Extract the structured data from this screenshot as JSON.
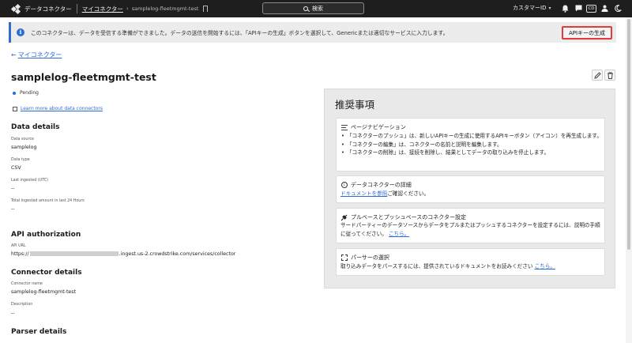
{
  "topbar": {
    "app_title": "データコネクター",
    "breadcrumb_link": "マイコネクター",
    "breadcrumb_current": "samplelog-fleetmgmt-test",
    "search_label": "検索",
    "customer_id_label": "カスタマーID",
    "cd_badge": "CD"
  },
  "banner": {
    "message": "このコネクターは、データを受信する準備ができました。データの送信を開始するには、「APIキーの生成」ボタンを選択して、Genericまたは適切なサービスに入力します。",
    "button_label": "APIキーの生成"
  },
  "back_link": "マイコネクター",
  "connector": {
    "title": "samplelog-fleetmgmt-test",
    "status": "Pending",
    "learn_more": "Learn more about data connectors"
  },
  "data_details": {
    "heading": "Data details",
    "source_label": "Data source",
    "source_value": "samplelog",
    "type_label": "Data type",
    "type_value": "CSV",
    "last_ingested_label": "Last ingested (UTC)",
    "last_ingested_value": "--",
    "total_label": "Total ingested amount in last 24 Hours",
    "total_value": "--"
  },
  "api_auth": {
    "heading": "API authorization",
    "url_label": "API URL",
    "url_prefix": "https://",
    "url_suffix": ".ingest.us-2.crowdstrike.com/services/collector"
  },
  "connector_details": {
    "heading": "Connector details",
    "name_label": "Connector name",
    "name_value": "samplelog-fleetmgmt-test",
    "desc_label": "Description",
    "desc_value": "--"
  },
  "parser_details": {
    "heading": "Parser details"
  },
  "recommendations": {
    "heading": "推奨事項",
    "page_nav": {
      "title": "ページナビゲーション",
      "items": [
        "「コネクターのプッシュ」は、新しいAPIキーの生成に使用するAPIキーボタン（アイコン）を再生成します。",
        "「コネクターの編集」は、コネクターの名前と説明を編集します。",
        "「コネクターの削除」は、接続を削除し、結果としてデータの取り込みを停止します。"
      ]
    },
    "detail": {
      "title": "データコネクターの詳細",
      "link": "ドキュメントを参照",
      "suffix": "ご確認ください。"
    },
    "pull_push": {
      "title": "プルベースとプッシュベースのコネクター設定",
      "body": "サードパーティーのデータソースからデータをプルまたはプッシュするコネクターを設定するには、説明の手順に従ってください。",
      "link": "こちら。"
    },
    "parser": {
      "title": "パーサーの選択",
      "body": "取り込みデータをパースするには、提供されているドキュメントをお読みください",
      "link": "こちら。"
    }
  }
}
